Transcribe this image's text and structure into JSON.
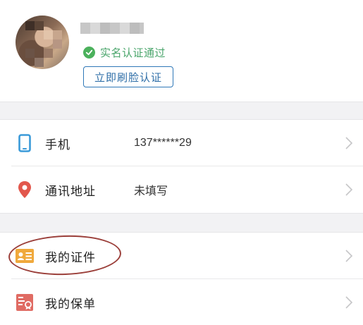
{
  "profile": {
    "verified_text": "实名认证通过",
    "face_button": "立即刷脸认证"
  },
  "rows": {
    "phone": {
      "label": "手机",
      "value": "137******29"
    },
    "address": {
      "label": "通讯地址",
      "value": "未填写"
    },
    "documents": {
      "label": "我的证件"
    },
    "policies": {
      "label": "我的保单"
    }
  },
  "colors": {
    "verified_green": "#4aa56b",
    "button_blue": "#2f78b8",
    "phone_icon_blue": "#3a9ad9",
    "location_icon_red": "#e2574c",
    "card_icon_orange": "#f0a93c",
    "policy_icon_red": "#e06b63",
    "annotation_oval": "#9b3f3a"
  }
}
